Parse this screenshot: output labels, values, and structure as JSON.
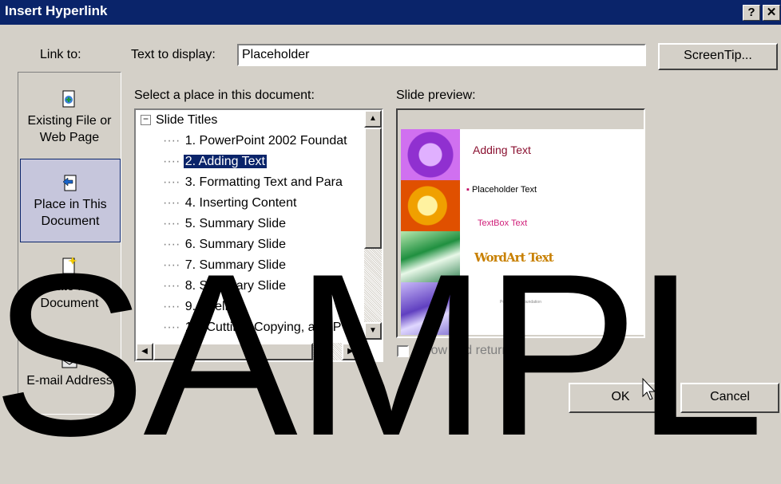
{
  "dialog": {
    "title": "Insert Hyperlink",
    "help_button": "?",
    "close_button": "✕"
  },
  "link_to": {
    "label": "Link to:",
    "items": [
      {
        "line1": "Existing File or",
        "line2": "Web Page",
        "selected": false
      },
      {
        "line1": "Place in This",
        "line2": "Document",
        "selected": true
      },
      {
        "line1": "Create New",
        "line2": "Document",
        "selected": false
      },
      {
        "line1": "E-mail Address",
        "line2": "",
        "selected": false
      }
    ]
  },
  "text_to_display": {
    "label": "Text to display:",
    "value": "Placeholder"
  },
  "screentip_button": "ScreenTip...",
  "place_list": {
    "label": "Select a place in this document:",
    "root": "Slide Titles",
    "items": [
      "1. PowerPoint 2002 Foundat",
      "2. Adding Text",
      "3. Formatting Text and Para",
      "4. Inserting Content",
      "5. Summary Slide",
      "6. Summary Slide",
      "7. Summary Slide",
      "8. Summary Slide",
      "9. Spelling",
      "10. Cutting, Copying, and P"
    ],
    "selected_index": 1
  },
  "preview": {
    "label": "Slide preview:",
    "slide_title": "Adding Text",
    "bullet": "Placeholder Text",
    "textbox": "TextBox Text",
    "wordart": "WordArt Text",
    "footer": "PowerPoint Foundation"
  },
  "show_and_return": {
    "label": "Show and return",
    "checked": false
  },
  "buttons": {
    "ok": "OK",
    "cancel": "Cancel"
  },
  "watermark": "SAMPL"
}
